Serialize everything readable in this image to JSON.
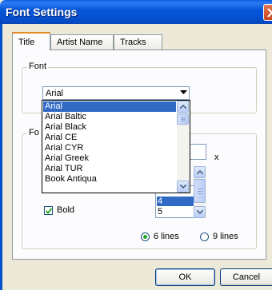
{
  "window": {
    "title": "Font Settings"
  },
  "tabs": [
    {
      "label": "Title",
      "selected": true
    },
    {
      "label": "Artist Name",
      "selected": false
    },
    {
      "label": "Tracks",
      "selected": false
    }
  ],
  "font_group": {
    "label": "Font",
    "combo_value": "Arial",
    "dropdown_items": [
      "Arial",
      "Arial Baltic",
      "Arial Black",
      "Arial CE",
      "Arial CYR",
      "Arial Greek",
      "Arial TUR",
      "Book Antiqua"
    ],
    "selected_item": "Arial"
  },
  "lower_group": {
    "label_fragment": "Fo",
    "x_label": "x",
    "size_list": [
      "4",
      "5"
    ],
    "selected_size": "4",
    "bold_label": "Bold",
    "bold_checked": true,
    "lines_options": [
      "6 lines",
      "9 lines"
    ],
    "lines_selected": "6 lines"
  },
  "buttons": {
    "ok": "OK",
    "cancel": "Cancel"
  },
  "colors": {
    "selection": "#316AC5",
    "titlebar": "#0550D0",
    "tab_highlight": "#E68B2C"
  }
}
